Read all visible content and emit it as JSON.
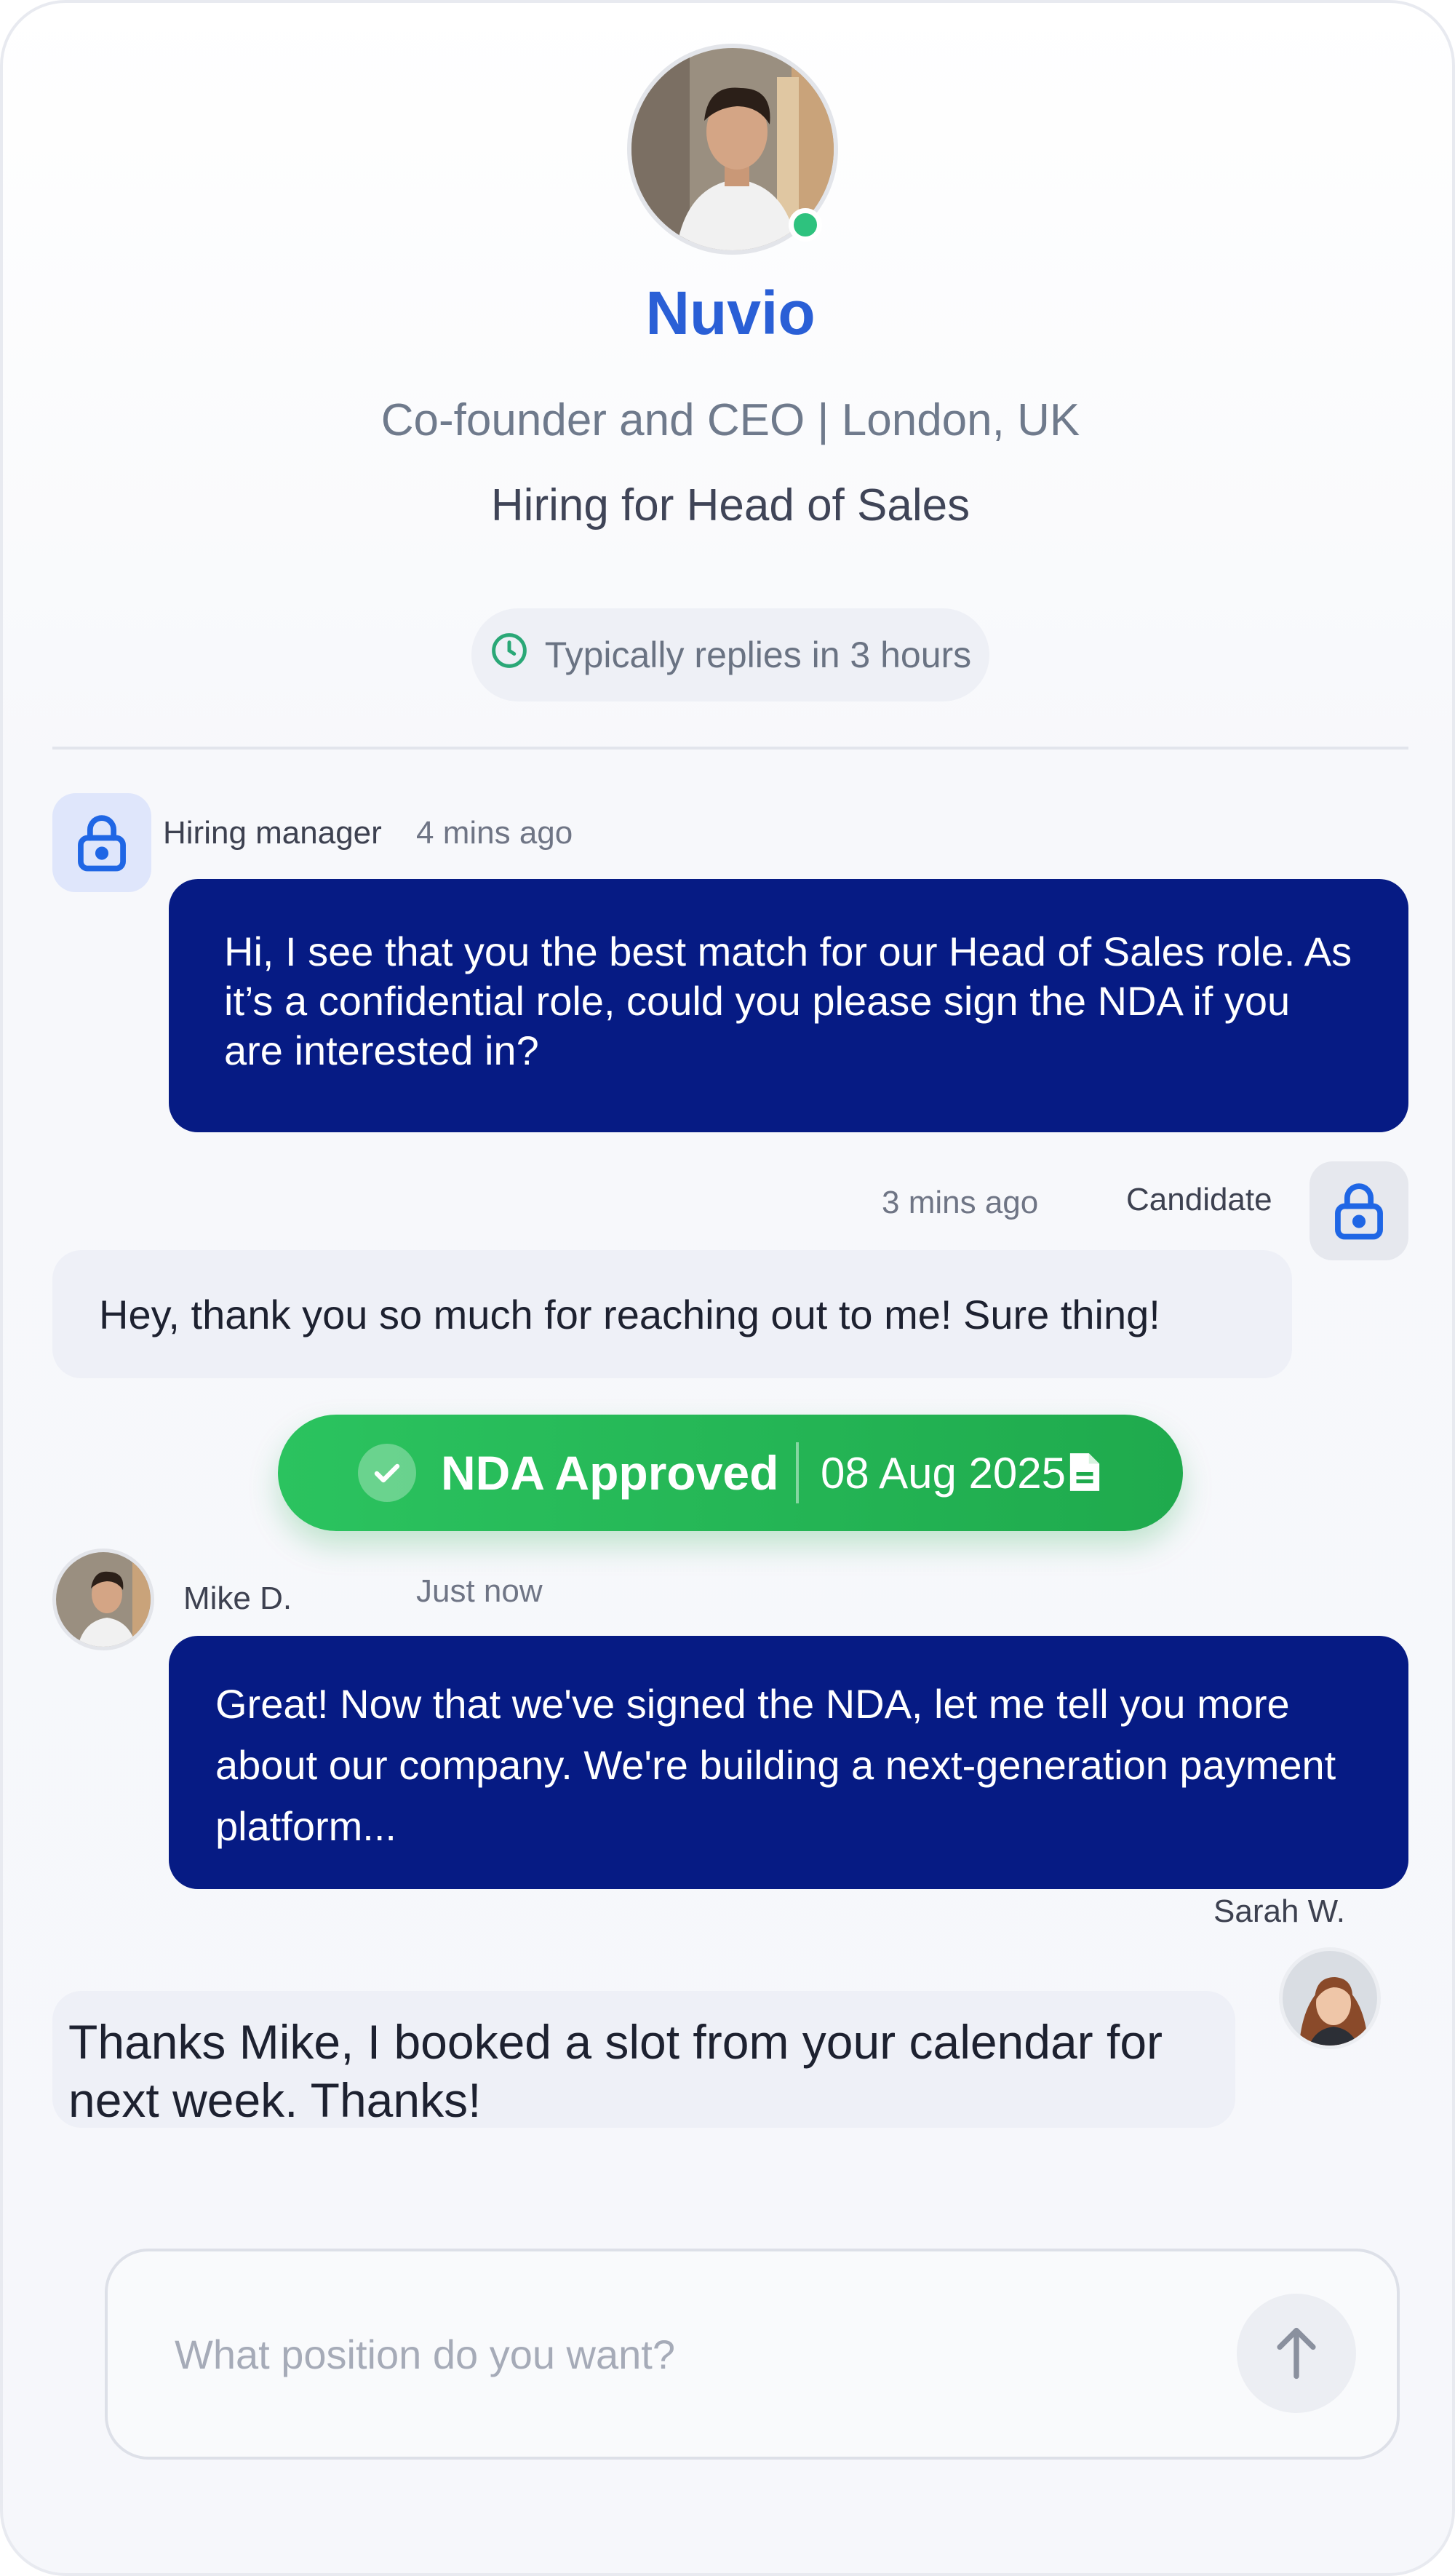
{
  "header": {
    "company": "Nuvio",
    "subtitle": "Co-founder and CEO | London, UK",
    "hiring": "Hiring for Head of Sales",
    "reply_time": "Typically replies in 3 hours"
  },
  "messages": [
    {
      "sender": "Hiring manager",
      "time": "4 mins ago",
      "text": "Hi, I see that you the best match for our Head of Sales role. As it’s a confidential role, could you please sign the NDA if you are interested in?"
    },
    {
      "sender": "Candidate",
      "time": "3 mins ago",
      "text": "Hey, thank you so much for reaching out to me! Sure thing!"
    },
    {
      "sender": "Mike D.",
      "time": "Just now",
      "text": "Great! Now that we've signed the NDA, let me tell you more about our company. We're building a next-generation payment platform..."
    },
    {
      "sender": "Sarah W.",
      "text": "Thanks Mike, I booked a slot from your calendar for next week. Thanks!"
    }
  ],
  "nda": {
    "label": "NDA Approved",
    "date": "08 Aug 2025"
  },
  "composer": {
    "placeholder": "What position do you want?",
    "value": ""
  },
  "icons": {
    "lock": "lock-icon",
    "clock": "clock-icon",
    "check": "check-icon",
    "document": "document-icon",
    "send": "arrow-up-icon"
  },
  "colors": {
    "brand": "#2a5fd6",
    "dark_bubble": "#061b84",
    "light_bubble": "#eef0f7",
    "success": "#22b455",
    "online": "#2ec27e",
    "lock_blue": "#1f66e5"
  }
}
